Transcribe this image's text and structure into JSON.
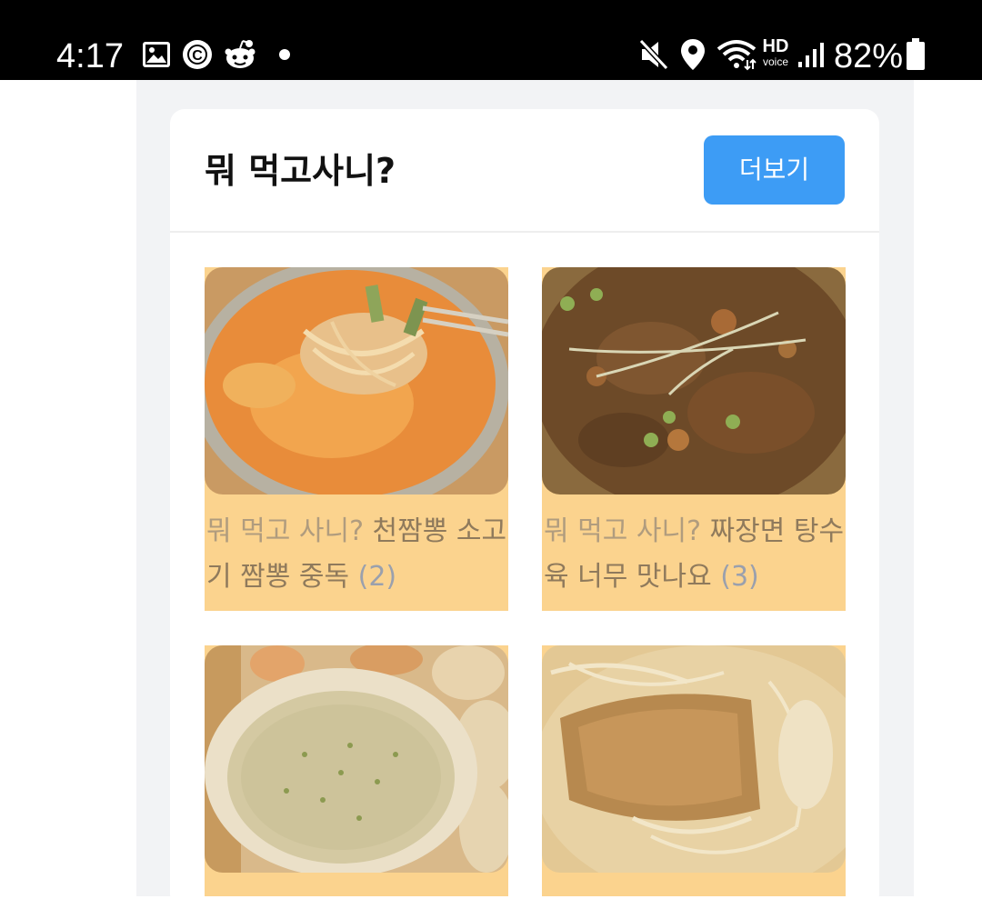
{
  "status_bar": {
    "time": "4:17",
    "battery_percent": "82%",
    "left_icons": [
      "gallery-icon",
      "c-badge-icon",
      "reddit-icon",
      "dot-icon"
    ],
    "right_icons": [
      "mute-icon",
      "location-icon",
      "wifi-icon",
      "hd-voice-icon",
      "signal-icon",
      "battery-icon"
    ],
    "hd_label": "HD",
    "voice_label": "voice"
  },
  "card": {
    "title": "뭐 먹고사니?",
    "more_label": "더보기"
  },
  "posts": [
    {
      "prefix": "뭐 먹고 사니?",
      "title": "천짬뽕 소고기 짬뽕 중독",
      "count": "(2)",
      "image": "spicy-noodle-soup-photo"
    },
    {
      "prefix": "뭐 먹고 사니?",
      "title": "짜장면 탕수육 너무 맛나요",
      "count": "(3)",
      "image": "black-bean-noodle-photo"
    },
    {
      "prefix": "",
      "title": "",
      "count": "",
      "image": "porridge-photo"
    },
    {
      "prefix": "",
      "title": "",
      "count": "",
      "image": "pork-cutlet-soup-photo"
    }
  ],
  "colors": {
    "status_bar_bg": "#000000",
    "page_bg": "#f2f3f5",
    "card_bg": "#ffffff",
    "button_accent": "#3d9cf5",
    "item_overlay": "#fbd38e",
    "caption_text": "#9c876a",
    "count_text": "#9aa0ad"
  }
}
